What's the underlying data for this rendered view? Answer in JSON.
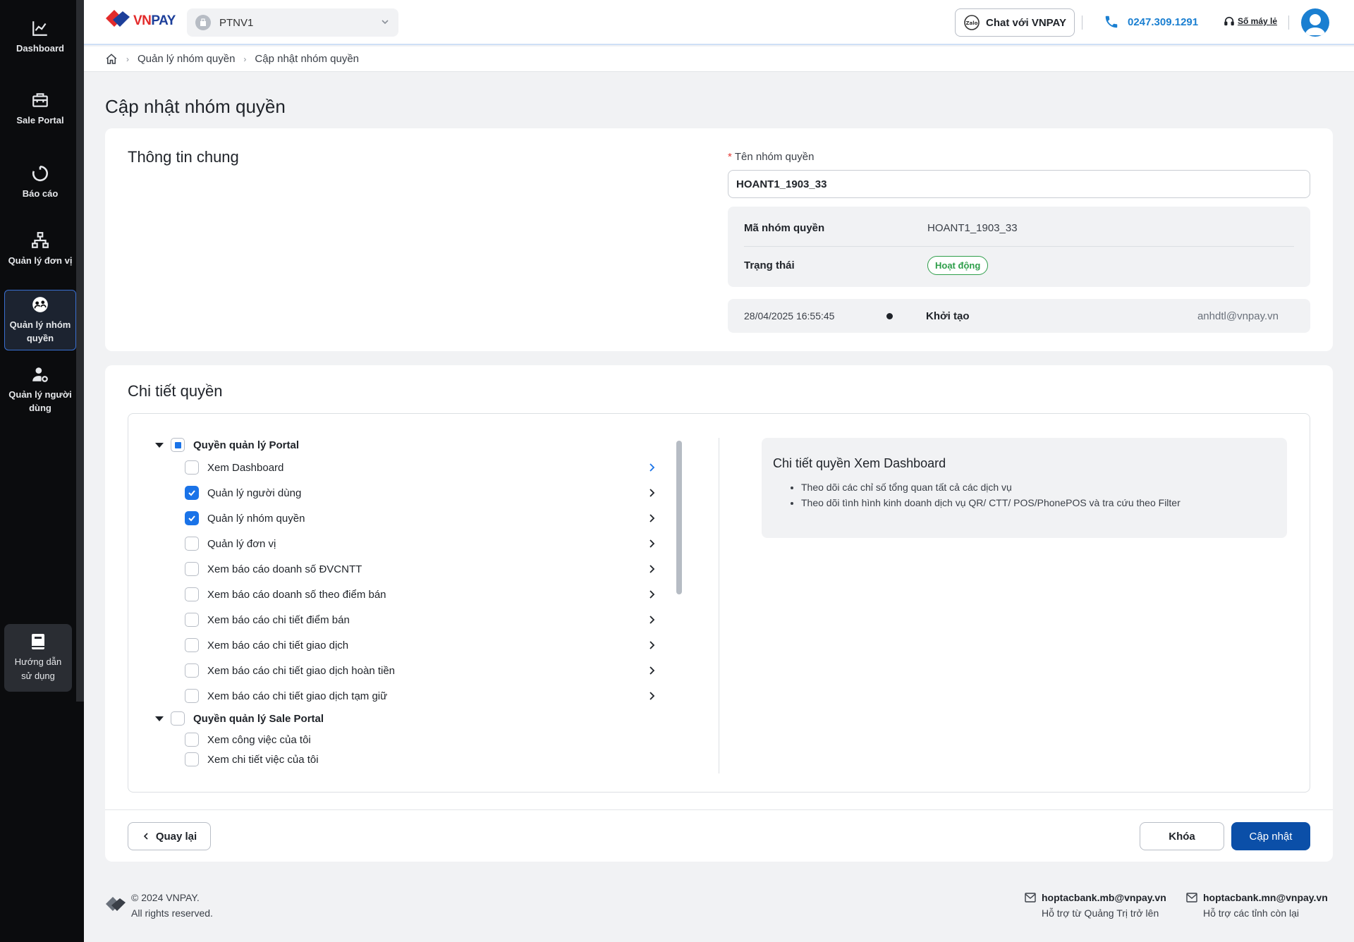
{
  "sidebar": {
    "items": [
      {
        "label": "Dashboard",
        "icon": "chart-line-icon"
      },
      {
        "label": "Sale Portal",
        "icon": "briefcase-icon"
      },
      {
        "label": "Báo cáo",
        "icon": "refresh-circle-icon"
      },
      {
        "label": "Quản lý đơn vị",
        "icon": "org-chart-icon"
      },
      {
        "label": "Quản lý nhóm quyền",
        "icon": "group-icon",
        "active": true
      },
      {
        "label": "Quản lý người dùng",
        "icon": "user-gear-icon"
      }
    ],
    "guide_label": "Hướng dẫn sử dụng"
  },
  "header": {
    "brand": {
      "vn": "VN",
      "pay": "PAY"
    },
    "tenant": "PTNV1",
    "chat_label": "Chat với VNPAY",
    "phone": "0247.309.1291",
    "hotline_label": "Số máy lẻ"
  },
  "breadcrumb": [
    "Quản lý nhóm quyền",
    "Cập nhật nhóm quyền"
  ],
  "page_title": "Cập nhật nhóm quyền",
  "general": {
    "title": "Thông tin chung",
    "name_label": "Tên nhóm quyền",
    "name_value": "HOANT1_1903_33",
    "code_label": "Mã nhóm quyền",
    "code_value": "HOANT1_1903_33",
    "status_label": "Trạng thái",
    "status_value": "Hoạt động",
    "log": {
      "time": "28/04/2025 16:55:45",
      "action": "Khởi tạo",
      "user": "anhdtl@vnpay.vn"
    }
  },
  "permissions": {
    "title": "Chi tiết quyền",
    "groups": [
      {
        "label": "Quyền quản lý Portal",
        "state": "partial",
        "items": [
          {
            "label": "Xem Dashboard",
            "checked": false,
            "selected": true
          },
          {
            "label": "Quản lý người dùng",
            "checked": true
          },
          {
            "label": "Quản lý nhóm quyền",
            "checked": true
          },
          {
            "label": "Quản lý đơn vị",
            "checked": false
          },
          {
            "label": "Xem báo cáo doanh số ĐVCNTT",
            "checked": false
          },
          {
            "label": "Xem báo cáo doanh số theo điểm bán",
            "checked": false
          },
          {
            "label": "Xem báo cáo chi tiết điểm bán",
            "checked": false
          },
          {
            "label": "Xem báo cáo chi tiết giao dịch",
            "checked": false
          },
          {
            "label": "Xem báo cáo chi tiết giao dịch hoàn tiền",
            "checked": false
          },
          {
            "label": "Xem báo cáo chi tiết giao dịch tạm giữ",
            "checked": false
          }
        ]
      },
      {
        "label": "Quyền quản lý Sale Portal",
        "state": "unchecked",
        "items": [
          {
            "label": "Xem công việc của tôi",
            "checked": false
          },
          {
            "label": "Xem chi tiết việc của tôi",
            "checked": false
          }
        ]
      }
    ],
    "detail": {
      "title": "Chi tiết quyền Xem Dashboard",
      "bullets": [
        "Theo dõi các chỉ số tổng quan tất cả các dịch vụ",
        "Theo dõi tình hình kinh doanh dịch vụ QR/ CTT/ POS/PhonePOS và tra cứu theo Filter"
      ]
    }
  },
  "actions": {
    "back": "Quay lại",
    "lock": "Khóa",
    "update": "Cập nhật"
  },
  "footer": {
    "copyright": "© 2024 VNPAY.",
    "rights": "All rights reserved.",
    "contacts": [
      {
        "email": "hoptacbank.mb@vnpay.vn",
        "note": "Hỗ trợ từ Quảng Trị trở lên"
      },
      {
        "email": "hoptacbank.mn@vnpay.vn",
        "note": "Hỗ trợ các tỉnh còn lại"
      }
    ]
  },
  "colors": {
    "primary": "#0b4fa8",
    "accent": "#1a73e8",
    "success": "#2e9e4a",
    "sidebar_bg": "#0b0c0e"
  }
}
